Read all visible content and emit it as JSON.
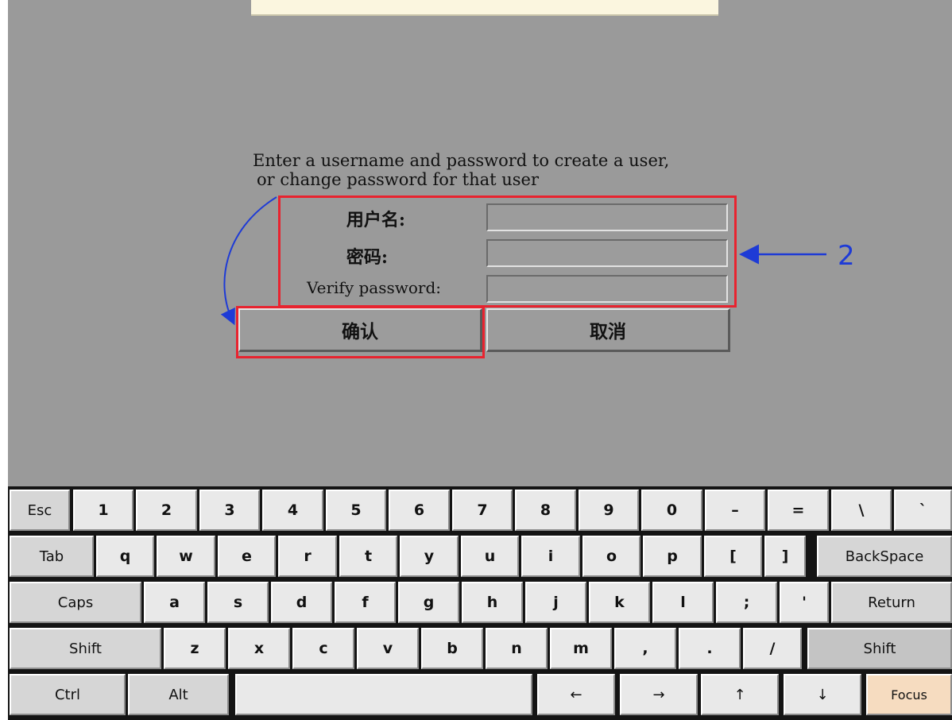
{
  "dialog": {
    "instructions_line1": "Enter a username and password to create a user,",
    "instructions_line2": "or change password for that user",
    "username_label": "用户名:",
    "password_label": "密码:",
    "verify_label": "Verify password:",
    "username_value": "",
    "password_value": "",
    "verify_value": "",
    "ok_label": "确认",
    "cancel_label": "取消"
  },
  "annotation": {
    "number": "2",
    "box_color": "#e8232f",
    "arrow_color": "#1e3bd6"
  },
  "keyboard": {
    "row1": [
      "Esc",
      "1",
      "2",
      "3",
      "4",
      "5",
      "6",
      "7",
      "8",
      "9",
      "0",
      "–",
      "=",
      "\\",
      "`"
    ],
    "row2": [
      "Tab",
      "q",
      "w",
      "e",
      "r",
      "t",
      "y",
      "u",
      "i",
      "o",
      "p",
      "[",
      "]",
      "BackSpace"
    ],
    "row3": [
      "Caps",
      "a",
      "s",
      "d",
      "f",
      "g",
      "h",
      "j",
      "k",
      "l",
      ";",
      "'",
      "Return"
    ],
    "row4": [
      "Shift",
      "z",
      "x",
      "c",
      "v",
      "b",
      "n",
      "m",
      ",",
      ".",
      "/",
      "Shift"
    ],
    "row5": [
      "Ctrl",
      "Alt",
      "",
      "←",
      "→",
      "↑",
      "↓",
      "Focus"
    ]
  }
}
